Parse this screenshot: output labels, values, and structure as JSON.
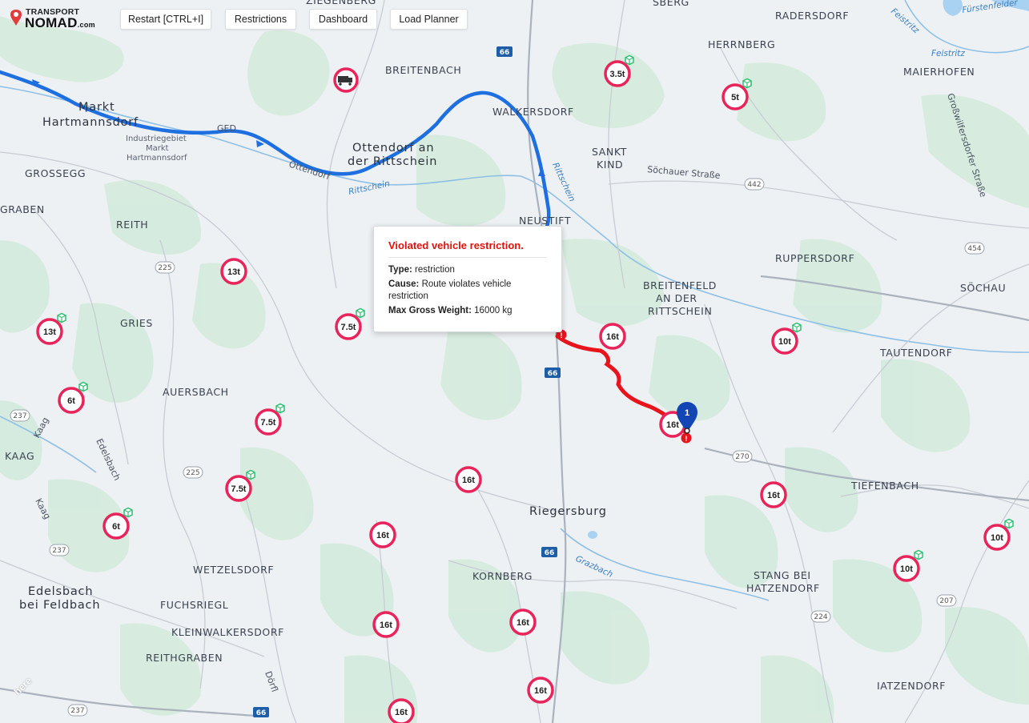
{
  "app": {
    "logo_top": "TRANSPORT",
    "logo_main": "NOMAD",
    "logo_suffix": ".com"
  },
  "toolbar": {
    "restart_label": "Restart [CTRL+I]",
    "restrictions_label": "Restrictions",
    "dashboard_label": "Dashboard",
    "load_planner_label": "Load Planner"
  },
  "popup": {
    "title": "Violated vehicle restriction.",
    "type_label": "Type:",
    "type_value": "restriction",
    "cause_label": "Cause:",
    "cause_value": "Route violates vehicle restriction",
    "weight_label": "Max Gross Weight:",
    "weight_value": "16000 kg"
  },
  "marker": {
    "number": "1"
  },
  "places": {
    "ziegenberg": "ZIEGENBERG",
    "sberg": "SBERG",
    "radersdorf": "RADERSDORF",
    "herrnberg": "HERRNBERG",
    "maierhofen": "MAIERHOFEN",
    "markt": "Markt",
    "hartmannsdorf": "Hartmannsdorf",
    "industrie1": "Industriegebiet",
    "industrie2": "Markt",
    "industrie3": "Hartmannsdorf",
    "breitenbach": "BREITENBACH",
    "walkersdorf": "WALKERSDORF",
    "ottendorf1": "Ottendorf an",
    "ottendorf2": "der Rittschein",
    "sankt": "SANKT",
    "kind": "KIND",
    "grossegg": "GROSSEGG",
    "graben": "GRABEN",
    "reith": "REITH",
    "neustift": "NEUSTIFT",
    "ruppersdorf": "RUPPERSDORF",
    "breitenfeld1": "BREITENFELD",
    "breitenfeld2": "AN DER",
    "breitenfeld3": "RITTSCHEIN",
    "sochau": "SÖCHAU",
    "gries": "GRIES",
    "tautendorf": "TAUTENDORF",
    "auersbach": "AUERSBACH",
    "kaag": "KAAG",
    "tiefenbach": "TIEFENBACH",
    "riegersburg": "Riegersburg",
    "wetzelsdorf": "WETZELSDORF",
    "kornberg": "KORNBERG",
    "stang1": "STANG BEI",
    "stang2": "HATZENDORF",
    "edelsbach1": "Edelsbach",
    "edelsbach2": "bei Feldbach",
    "fuchsriegl": "FUCHSRIEGL",
    "kleinwalkersdorf": "KLEINWALKERSDORF",
    "reithgraben": "REITHGRABEN",
    "iatzendorf": "IATZENDORF"
  },
  "roads": {
    "ged": "GED",
    "ottendorf_road": "Ottendorf",
    "sochauer": "Söchauer Straße",
    "grosswilfersdorfer": "Großwilfersdorfer Straße",
    "kaag1": "Kaag",
    "kaag2": "Kaag",
    "edelsbach_road": "Edelsbach",
    "dorfl": "Dörfl"
  },
  "rivers": {
    "feistritz1": "Feistritz",
    "feistritz2": "Feistritz",
    "rittschein1": "Rittschein",
    "rittschein2": "Rittschein",
    "grazbach": "Grazbach",
    "furstenfelder": "Fürstenfelder"
  },
  "shields": {
    "r66a": "66",
    "r66b": "66",
    "r66c": "66",
    "r66d": "66",
    "r442": "442",
    "r454": "454",
    "r225a": "225",
    "r225b": "225",
    "r237a": "237",
    "r237b": "237",
    "r237c": "237",
    "r270": "270",
    "r224": "224",
    "r207": "207"
  },
  "signs": {
    "s1": "3.5t",
    "s2": "5t",
    "s3": "13t",
    "s4": "7.5t",
    "s5": "16t",
    "s6": "10t",
    "s7": "13t",
    "s8": "6t",
    "s9": "7.5t",
    "s10": "7.5t",
    "s11": "16t",
    "s12": "16t",
    "s13": "6t",
    "s14": "16t",
    "s15": "10t",
    "s16": "10t",
    "s17": "16t",
    "s18": "16t",
    "s19": "16t",
    "s20": "16t",
    "s21": "16t"
  },
  "colors": {
    "route_blue": "#1e6fe0",
    "route_violation": "#e8141b",
    "sign_ring": "#e8245a",
    "truck_cube": "#2fbf71",
    "popup_title": "#e0120f",
    "marker_blue": "#1346b4"
  }
}
